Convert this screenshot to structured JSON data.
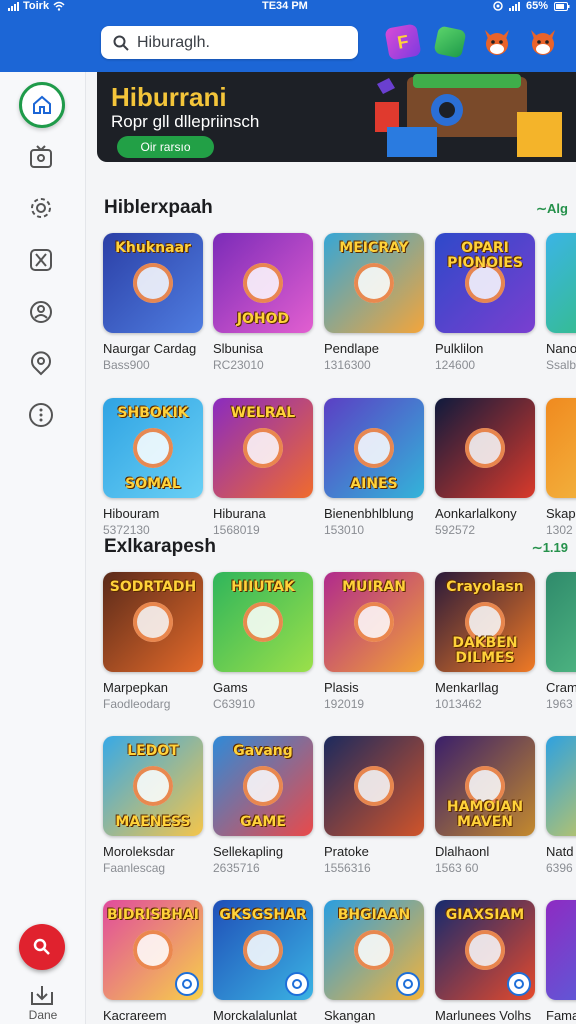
{
  "status": {
    "carrier": "Toirk",
    "time": "TE34 PM",
    "battery": "65%"
  },
  "search": {
    "placeholder": "Hiburaglh."
  },
  "top_icons": [
    "letter-tile-icon",
    "cube-icon",
    "fox-avatar-icon",
    "fox-avatar-icon"
  ],
  "sidebar": {
    "items": [
      "home-icon",
      "tv-icon",
      "settings-icon",
      "x-box-icon",
      "profile-icon",
      "person-pin-icon",
      "more-icon"
    ],
    "bottom_label": "Dane"
  },
  "banner": {
    "title": "Hiburrani",
    "subtitle": "Ropr gll dllepriinsch",
    "button": "Oir rarsıo"
  },
  "sections": [
    {
      "title": "Hiblerxpaah",
      "more": "∼Alg"
    },
    {
      "title": "Exlkarapesh",
      "more": "∼1.19"
    }
  ],
  "tiles": [
    {
      "name": "Naurgar Cardag",
      "meta": "Bass900",
      "top": "Khuknaar",
      "bottom": "",
      "bg": [
        "#2b3fa6",
        "#4f7de0"
      ]
    },
    {
      "name": "Slbunisa",
      "meta": "RC23010",
      "top": "",
      "bottom": "JOHOD",
      "bg": [
        "#7b2bb8",
        "#e25fd0"
      ]
    },
    {
      "name": "Pendlape",
      "meta": "1316300",
      "top": "MEICRAY",
      "bottom": "",
      "bg": [
        "#36a6d6",
        "#f3a53b"
      ]
    },
    {
      "name": "Pulklilon",
      "meta": "124600",
      "top": "OPARI PIONOIES",
      "bottom": "",
      "bg": [
        "#2e49c9",
        "#7a3fd0"
      ]
    },
    {
      "name": "Nanor",
      "meta": "Ssalb",
      "top": "",
      "bottom": "",
      "bg": [
        "#3bb4e6",
        "#33c06a"
      ]
    },
    {
      "name": "Hibouram",
      "meta": "5372130",
      "top": "SHBOKIK",
      "bottom": "SOMAL",
      "bg": [
        "#2fa3e3",
        "#6ad0f5"
      ]
    },
    {
      "name": "Hiburana",
      "meta": "1568019",
      "top": "WELRAL",
      "bottom": "",
      "bg": [
        "#8a2bc0",
        "#f06b2d"
      ]
    },
    {
      "name": "Bienenbhlblung",
      "meta": "153010",
      "top": "",
      "bottom": "AINES",
      "bg": [
        "#5b3fc4",
        "#33b4d9"
      ]
    },
    {
      "name": "Aonkarlalkony",
      "meta": "592572",
      "top": "",
      "bottom": "",
      "bg": [
        "#0f1a3d",
        "#d93a2b"
      ]
    },
    {
      "name": "Skap",
      "meta": "1302",
      "top": "",
      "bottom": "",
      "bg": [
        "#f08a1f",
        "#f4c24a"
      ]
    },
    {
      "name": "Marpepkan",
      "meta": "Faodleodarg",
      "top": "SODRTADH",
      "bottom": "",
      "bg": [
        "#5a2a1a",
        "#e36a2a"
      ]
    },
    {
      "name": "Gams",
      "meta": "C63910",
      "top": "HIIUTAK",
      "bottom": "",
      "bg": [
        "#2fb55b",
        "#9be04a"
      ]
    },
    {
      "name": "Plasis",
      "meta": "192019",
      "top": "MUIRAN",
      "bottom": "",
      "bg": [
        "#b02a8d",
        "#f2a236"
      ]
    },
    {
      "name": "Menkarllag",
      "meta": "1013462",
      "top": "Crayolasn",
      "bottom": "DAKBEN DILMES",
      "bg": [
        "#2a1a3a",
        "#f07a25"
      ]
    },
    {
      "name": "Cramo",
      "meta": "1963",
      "top": "",
      "bottom": "",
      "bg": [
        "#2f8a6b",
        "#5bc78b"
      ]
    },
    {
      "name": "Moroleksdar",
      "meta": "Faanlescag",
      "top": "LEDOT",
      "bottom": "MAENESS",
      "bg": [
        "#37a9e6",
        "#f4c54b"
      ]
    },
    {
      "name": "Sellekapling",
      "meta": "2635716",
      "top": "Gavang",
      "bottom": "GAME",
      "bg": [
        "#2f8ad8",
        "#e94a4a"
      ]
    },
    {
      "name": "Pratoke",
      "meta": "1556316",
      "top": "",
      "bottom": "",
      "bg": [
        "#1c2a5e",
        "#d0542a"
      ]
    },
    {
      "name": "Dlalhaonl",
      "meta": "1563 60",
      "top": "",
      "bottom": "HAMOIAN MAVEN",
      "bg": [
        "#3a1f6a",
        "#c48a2e"
      ]
    },
    {
      "name": "Natd",
      "meta": "6396",
      "top": "",
      "bottom": "",
      "bg": [
        "#2ea1e0",
        "#f2d23a"
      ]
    },
    {
      "name": "Kacrareem",
      "meta": "",
      "top": "BIDRISBHAI",
      "bottom": "",
      "bg": [
        "#e04b9d",
        "#f7d04a"
      ]
    },
    {
      "name": "Morckalalunlat",
      "meta": "",
      "top": "GKSGSHAR",
      "bottom": "",
      "bg": [
        "#1f4fb8",
        "#3bb3e3"
      ]
    },
    {
      "name": "Skangan",
      "meta": "",
      "top": "BHGIAAN",
      "bottom": "",
      "bg": [
        "#2a9ee0",
        "#f4b33a"
      ]
    },
    {
      "name": "Marlunees Volhs",
      "meta": "",
      "top": "GIAXSIAM",
      "bottom": "",
      "bg": [
        "#162a6e",
        "#e54a2c"
      ]
    },
    {
      "name": "Fama",
      "meta": "",
      "top": "",
      "bottom": "",
      "bg": [
        "#8e2bc2",
        "#4a6de0"
      ]
    }
  ],
  "colors": {
    "brand": "#1c66d6",
    "accent": "#1f9b4a",
    "fab": "#e0222e"
  }
}
